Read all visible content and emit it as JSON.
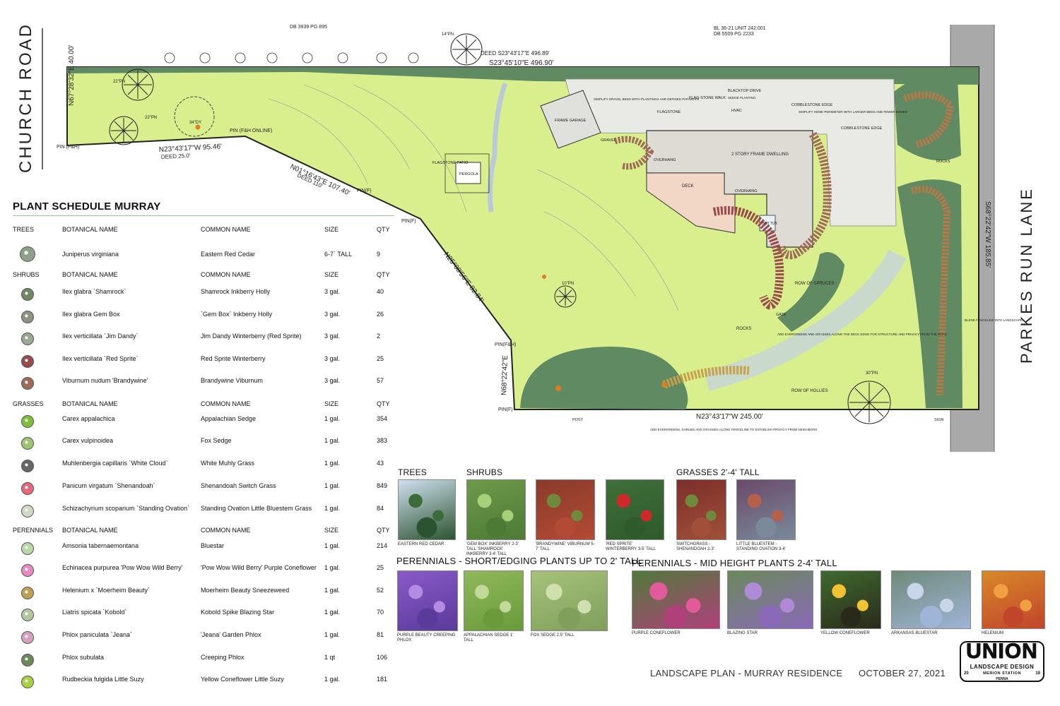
{
  "plan": {
    "road_west": "CHURCH ROAD",
    "road_east": "PARKES RUN LANE",
    "deed_top_1": "DB 3939 PG 895",
    "deed_top_2": "BL 36-21 UNIT 242:001",
    "deed_top_3": "DB 5509 PG 2233",
    "deed_top_4": "DEED S23°43'17\"E 496.89'",
    "bearing_top": "S23°45'10\"E 496.90'",
    "bearing_west": "N67°28'32\"E 40.00'",
    "bearing_nw": "N23°43'17\"W 95.46'",
    "deed_nw": "DEED 25.0'",
    "bearing_slope": "N01°16'43\"E 107.40'",
    "deed_slope": "DEED 110'",
    "bearing_mid": "N25°08'56\"E 82.84'",
    "bearing_south": "N68°22'42\"E",
    "bearing_bottom": "N23°43'17\"W 245.00'",
    "bearing_east": "S68°22'42\"W 185.85'",
    "pins": [
      "PIN (F&H)",
      "PIN (F&H ONLINE)",
      "PIN(F)",
      "PIN(F)",
      "PIN(F&H)",
      "PIN(F)"
    ],
    "labels": {
      "flagstone_patio": "FLAGSTONE PATIO",
      "pergola": "PERGOLA",
      "frame_garage": "FRAME GARAGE",
      "gravel": "GRAVEL",
      "flagstone": "FLAGSTONE",
      "flagstone_walk": "FLAG-STONE WALK",
      "blacktop": "BLACKTOP DRIVE",
      "cobblestone_edge": "COBBLESTONE EDGE",
      "cobblestone_edge_2": "COBBLESTONE EDGE",
      "dwelling": "2 STORY FRAME DWELLING",
      "overhang": "OVERHANG",
      "overhang_2": "OVERHANG",
      "deck": "DECK",
      "hot_tub": "HOT TUB",
      "row_of_spruces": "ROW OF SPRUCES",
      "row_of_hollies": "ROW OF HOLLIES",
      "rocks": "ROCKS",
      "rocks_2": "ROCKS",
      "sign": "SIGN",
      "post": "POST",
      "gate": "GATE",
      "hvac": "HVAC",
      "tree_34": "34\"DY",
      "tree_22a": "22\"PN",
      "tree_22b": "22\"PN",
      "tree_14": "14\"PN",
      "tree_10": "10\"PN",
      "tree_30": "30\"PN"
    },
    "notes": {
      "gravel_beds": "SIMPLIFY GRAVEL BEDS WITH PLANTINGS AND DEFINED PATHWAYS",
      "sedge": "SEDGE PLANTING",
      "perimeter": "SIMPLIFY HOME PERIMETER WITH LARGER BEDS AND FEWER EDGES",
      "evergreens": "ADD EVERGREENS AND GRASSES ALONG THE DECK EDGE FOR STRUCTURE AND PRIVACY FROM THE ROAD",
      "fenceline": "BLEND FENCELINE INTO LANDSCAPE",
      "south": "ADD EVERGREENS, SHRUBS AND GRASSES ALONG FENCELINE TO ESTABLISH PRIVACY FROM NEIGHBORS"
    }
  },
  "schedule": {
    "title": "PLANT SCHEDULE MURRAY",
    "groups": [
      {
        "category": "TREES",
        "h_botanical": "BOTANICAL NAME",
        "h_common": "COMMON NAME",
        "h_size": "SIZE",
        "h_qty": "QTY",
        "rows": [
          {
            "symbol": "juniper-symbol",
            "color": "#8fa08a",
            "botanical": "Juniperus virginiana",
            "common": "Eastern Red Cedar",
            "size": "6-7` TALL",
            "qty": "9"
          }
        ]
      },
      {
        "category": "SHRUBS",
        "h_botanical": "BOTANICAL NAME",
        "h_common": "COMMON NAME",
        "h_size": "SIZE",
        "h_qty": "QTY",
        "rows": [
          {
            "symbol": "shrub-symbol",
            "color": "#6f8a63",
            "botanical": "Ilex glabra `Shamrock`",
            "common": "Shamrock Inkberry Holly",
            "size": "3 gal.",
            "qty": "40"
          },
          {
            "symbol": "shrub-symbol",
            "color": "#8a9580",
            "botanical": "Ilex glabra Gem Box",
            "common": "`Gem Box` Inkberry Holly",
            "size": "3 gal.",
            "qty": "26"
          },
          {
            "symbol": "shrub-symbol",
            "color": "#9aa890",
            "botanical": "Ilex verticillata `Jim Dandy`",
            "common": "Jim Dandy Winterberry (Red Sprite)",
            "size": "3 gal.",
            "qty": "2"
          },
          {
            "symbol": "shrub-symbol",
            "color": "#9a4a4a",
            "botanical": "Ilex verticillata `Red Sprite`",
            "common": "Red Sprite Winterberry",
            "size": "3 gal.",
            "qty": "25"
          },
          {
            "symbol": "shrub-symbol",
            "color": "#a06a58",
            "botanical": "Viburnum nudum 'Brandywine'",
            "common": "Brandywine Viburnum",
            "size": "3 gal.",
            "qty": "57"
          }
        ]
      },
      {
        "category": "GRASSES",
        "h_botanical": "BOTANICAL NAME",
        "h_common": "COMMON NAME",
        "h_size": "SIZE",
        "h_qty": "QTY",
        "rows": [
          {
            "symbol": "grass-symbol",
            "color": "#7fbf3a",
            "botanical": "Carex appalachica",
            "common": "Appalachian Sedge",
            "size": "1 gal.",
            "qty": "354"
          },
          {
            "symbol": "grass-symbol",
            "color": "#9ec56e",
            "botanical": "Carex vulpinoidea",
            "common": "Fox Sedge",
            "size": "1 gal.",
            "qty": "383"
          },
          {
            "symbol": "grass-symbol",
            "color": "#666666",
            "botanical": "Muhlenbergia capillaris `White Cloud`",
            "common": "White Muhly Grass",
            "size": "1 gal.",
            "qty": "43"
          },
          {
            "symbol": "grass-symbol",
            "color": "#e06a7a",
            "botanical": "Panicum virgatum `Shenandoah`",
            "common": "Shenandoah Switch Grass",
            "size": "1 gal.",
            "qty": "849"
          },
          {
            "symbol": "grass-symbol",
            "color": "#cfd9c2",
            "botanical": "Schizachyrium scoparium `Standing Ovation`",
            "common": "Standing Ovation Little Bluestem Grass",
            "size": "1 gal.",
            "qty": "84"
          }
        ]
      },
      {
        "category": "PERENNIALS",
        "h_botanical": "BOTANICAL NAME",
        "h_common": "COMMON NAME",
        "h_size": "SIZE",
        "h_qty": "QTY",
        "rows": [
          {
            "symbol": "perennial-symbol",
            "color": "#b8d8a8",
            "botanical": "Amsonia tabernaemontana",
            "common": "Bluestar",
            "size": "1 gal.",
            "qty": "214"
          },
          {
            "symbol": "perennial-symbol",
            "color": "#e88ac0",
            "botanical": "Echinacea purpurea 'Pow Wow Wild Berry'",
            "common": "'Pow Wow Wild Berry' Purple Coneflower",
            "size": "1 gal.",
            "qty": "25"
          },
          {
            "symbol": "perennial-symbol",
            "color": "#c0a050",
            "botanical": "Helenium x `Moerheim Beauty`",
            "common": "Moerheim Beauty Sneezeweed",
            "size": "1 gal.",
            "qty": "52"
          },
          {
            "symbol": "perennial-symbol",
            "color": "#b0c8a0",
            "botanical": "Liatris spicata `Kobold`",
            "common": "Kobold Spike Blazing Star",
            "size": "1 gal.",
            "qty": "70"
          },
          {
            "symbol": "perennial-symbol",
            "color": "#d8a0c0",
            "botanical": "Phlox paniculata `Jeana`",
            "common": "'Jeana' Garden Phlox",
            "size": "1 gal.",
            "qty": "81"
          },
          {
            "symbol": "perennial-symbol",
            "color": "#6a8a5a",
            "botanical": "Phlox subulata",
            "common": "Creeping Phlox",
            "size": "1 qt",
            "qty": "106"
          },
          {
            "symbol": "perennial-symbol",
            "color": "#a8d040",
            "botanical": "Rudbeckia fulgida Little Suzy",
            "common": "Yellow Coneflower Little Suzy",
            "size": "1 gal.",
            "qty": "181"
          }
        ]
      }
    ]
  },
  "gallery": {
    "h_trees": "TREES",
    "h_shrubs": "SHRUBS",
    "h_grasses": "GRASSES 2'-4' TALL",
    "h_short": "PERENNIALS - SHORT/EDGING PLANTS UP TO 2' TALL",
    "h_mid": "PERENNIALS - MID HEIGHT PLANTS 2-4' TALL",
    "photos": [
      {
        "caption": "EASTERN RED CEDAR",
        "subject": "cedar"
      },
      {
        "caption": "'GEM BOX' INKBERRY 2-3' TALL 'SHAMROCK' INKBERRY 3-4' TALL",
        "subject": "inkberry"
      },
      {
        "caption": "'BRANDYWINE' VIBURNUM 5-7' TALL",
        "subject": "viburnum"
      },
      {
        "caption": "'RED SPRITE' WINTERBERRY 3-5' TALL",
        "subject": "winterberry"
      },
      {
        "caption": "SWITCHGRASS - SHENANDOAH 2-3'",
        "subject": "switchgrass"
      },
      {
        "caption": "LITTLE BLUESTEM - STANDING OVATION 3-4'",
        "subject": "bluestem"
      },
      {
        "caption": "PURPLE BEAUTY CREEPING PHLOX",
        "subject": "phlox"
      },
      {
        "caption": "APPALACHIAN SEDGE 1' TALL",
        "subject": "sedge"
      },
      {
        "caption": "FOX SEDGE 2.5' TALL",
        "subject": "foxsedge"
      },
      {
        "caption": "PURPLE CONEFLOWER",
        "subject": "coneflower"
      },
      {
        "caption": "BLAZING STAR",
        "subject": "blazingstar"
      },
      {
        "caption": "YELLOW CONEFLOWER",
        "subject": "rudbeckia"
      },
      {
        "caption": "ARKANSAS BLUESTAR",
        "subject": "amsonia"
      },
      {
        "caption": "HELENIUM",
        "subject": "helenium"
      }
    ]
  },
  "footer": {
    "title": "LANDSCAPE PLAN - MURRAY RESIDENCE",
    "date": "OCTOBER 27, 2021"
  },
  "logo": {
    "word": "UNION",
    "sub": "LANDSCAPE DESIGN",
    "place": "MERION STATION",
    "year_a": "20",
    "year_b": "19",
    "state": "PENNA"
  },
  "colors": {
    "lawn": "#d9ef8e",
    "woods": "#5f8a62",
    "road": "#a9a9a9",
    "house": "#e4e4df",
    "deck": "#f2d6c6",
    "path": "#b9cad6"
  }
}
